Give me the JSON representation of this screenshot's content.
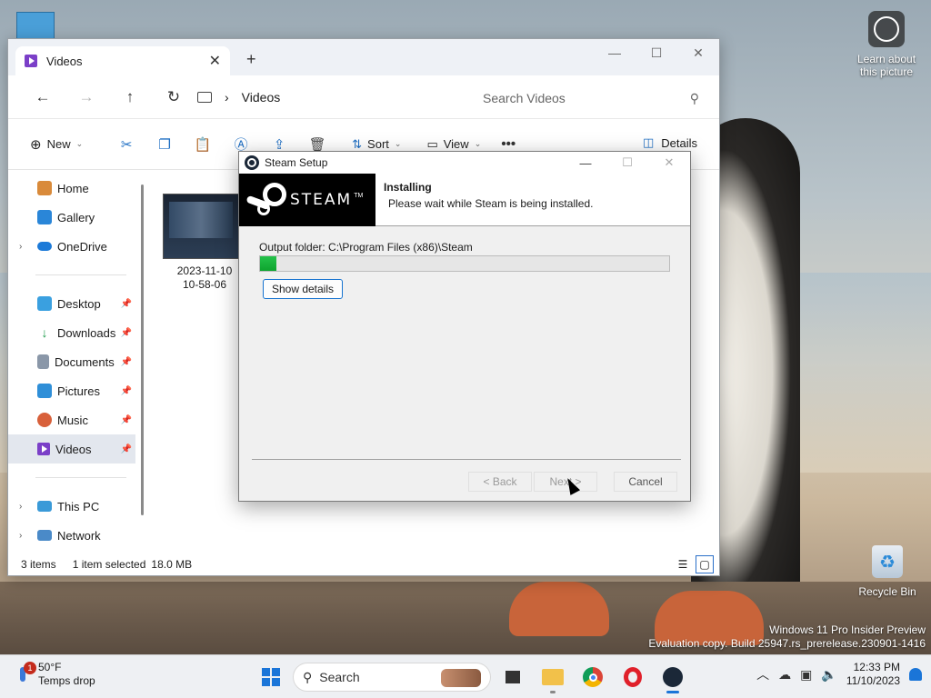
{
  "desktop": {
    "learn_label": "Learn about\nthis picture",
    "recycle_label": "Recycle Bin",
    "watermark_line1": "Windows 11 Pro Insider Preview",
    "watermark_line2": "Evaluation copy. Build 25947.rs_prerelease.230901-1416"
  },
  "explorer": {
    "tab_title": "Videos",
    "new_tab": "+",
    "breadcrumb": "Videos",
    "search_placeholder": "Search Videos",
    "toolbar": {
      "new_label": "New",
      "sort_label": "Sort",
      "view_label": "View",
      "details_label": "Details"
    },
    "sidebar": [
      {
        "label": "Home"
      },
      {
        "label": "Gallery"
      },
      {
        "label": "OneDrive"
      },
      {
        "label": "Desktop"
      },
      {
        "label": "Downloads"
      },
      {
        "label": "Documents"
      },
      {
        "label": "Pictures"
      },
      {
        "label": "Music"
      },
      {
        "label": "Videos"
      },
      {
        "label": "This PC"
      },
      {
        "label": "Network"
      }
    ],
    "file": {
      "name_line1": "2023-11-10",
      "name_line2": "10-58-06"
    },
    "status": {
      "items": "3 items",
      "selected": "1 item selected",
      "size": "18.0 MB"
    }
  },
  "steam": {
    "window_title": "Steam Setup",
    "banner_word": "STEAM",
    "banner_tm": "TM",
    "header_title": "Installing",
    "header_sub": "Please wait while Steam is being installed.",
    "output_folder": "Output folder: C:\\Program Files (x86)\\Steam",
    "progress_percent": 4,
    "show_details": "Show details",
    "back": "< Back",
    "next": "Next >",
    "cancel": "Cancel"
  },
  "taskbar": {
    "temp": "50°F",
    "weather_desc": "Temps drop",
    "weather_badge": "1",
    "search_label": "Search",
    "time": "12:33 PM",
    "date": "11/10/2023"
  },
  "colors": {
    "accent": "#1a75d8",
    "progress_green": "#0ea42e",
    "videos_purple": "#7b3fc8"
  }
}
